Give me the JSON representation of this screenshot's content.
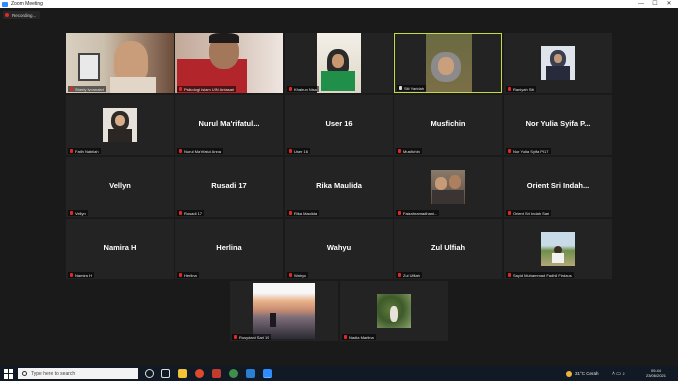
{
  "window": {
    "title": "Zoom Meeting",
    "minimize": "—",
    "maximize": "☐",
    "close": "✕"
  },
  "recording": {
    "label": "Recording..."
  },
  "tiles": [
    {
      "caption": "Sherly Ivonnakrt",
      "name": ""
    },
    {
      "caption": "Psikologi Islam UIN Antasari",
      "name": ""
    },
    {
      "caption": "Khairun Nisa",
      "name": ""
    },
    {
      "caption": "Siti Yaridah",
      "name": ""
    },
    {
      "caption": "Raniyah Siti",
      "name": ""
    },
    {
      "caption": "Fatih Nabilah",
      "name": ""
    },
    {
      "caption": "Nurul Ma'rifatul Anna",
      "name": "Nurul  Ma'rifatul..."
    },
    {
      "caption": "User 16",
      "name": "User 16"
    },
    {
      "caption": "Musfichin",
      "name": "Musfichin"
    },
    {
      "caption": "Nor Yulia Syifa PI17",
      "name": "Nor Yulia Syifa P..."
    },
    {
      "caption": "Vellyn",
      "name": "Vellyn"
    },
    {
      "caption": "Rusadi 17",
      "name": "Rusadi 17"
    },
    {
      "caption": "Rika Maulida",
      "name": "Rika Maulida"
    },
    {
      "caption": "Faizahramadhani...",
      "name": ""
    },
    {
      "caption": "Orient Sri Indah Sari",
      "name": "Orient Sri Indah..."
    },
    {
      "caption": "Namira H",
      "name": "Namira H"
    },
    {
      "caption": "Herlina",
      "name": "Herlina"
    },
    {
      "caption": "Wahyu",
      "name": "Wahyu"
    },
    {
      "caption": "Zul Ulfiah",
      "name": "Zul Ulfiah"
    },
    {
      "caption": "Sayid Muhammad Fadhil Firdaus",
      "name": ""
    },
    {
      "caption": "Rusydani Sari 19",
      "name": ""
    },
    {
      "caption": "Nadia Marlina",
      "name": ""
    }
  ],
  "taskbar": {
    "search_placeholder": "Type here to search",
    "weather": "31°C  Cerah",
    "time": "09.44",
    "date": "23/06/2021"
  },
  "colors": {
    "active_speaker": "#c6da3f",
    "muted_mic": "#e02828",
    "accent": "#2d8cff"
  }
}
